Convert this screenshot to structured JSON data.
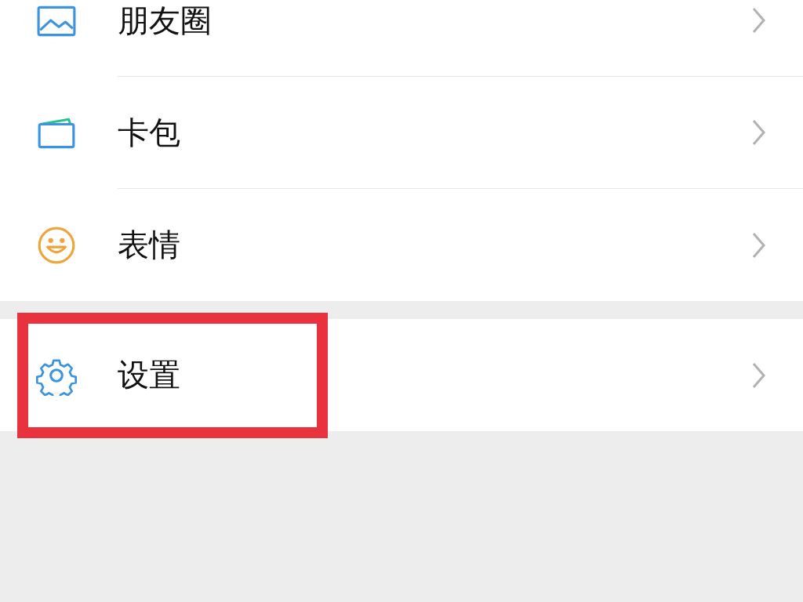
{
  "groups": [
    {
      "items": [
        {
          "kind": "moments",
          "label": "朋友圈",
          "highlighted": false
        },
        {
          "kind": "cards",
          "label": "卡包",
          "highlighted": false
        },
        {
          "kind": "stickers",
          "label": "表情",
          "highlighted": false
        }
      ]
    },
    {
      "items": [
        {
          "kind": "settings",
          "label": "设置",
          "highlighted": true
        }
      ]
    }
  ]
}
